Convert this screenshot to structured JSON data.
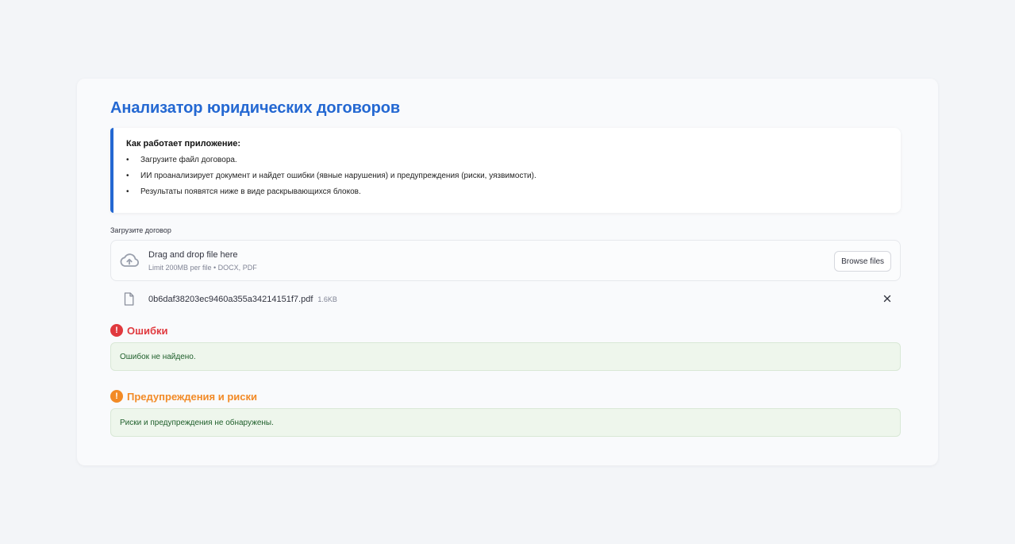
{
  "app": {
    "title": "Анализатор юридических договоров",
    "accent_color": "#2468d2"
  },
  "info": {
    "heading": "Как работает приложение:",
    "bullet": "•",
    "items": [
      "Загрузите файл договора.",
      "ИИ проанализирует документ и найдет ошибки (явные нарушения) и предупреждения (риски, уязвимости).",
      "Результаты появятся ниже в виде раскрывающихся блоков."
    ]
  },
  "uploader": {
    "label": "Загрузите договор",
    "drop_text": "Drag and drop file here",
    "limit_text": "Limit 200MB per file • DOCX, PDF",
    "browse_label": "Browse files",
    "icon": "cloud-upload-icon"
  },
  "uploaded_file": {
    "name": "0b6daf38203ec9460a355a34214151f7.pdf",
    "size": "1.6KB",
    "icon": "file-icon",
    "remove_icon": "close-icon"
  },
  "errors": {
    "title": "Ошибки",
    "badge": "!",
    "color": "#e0393e",
    "message": "Ошибок не найдено."
  },
  "warnings": {
    "title": "Предупреждения и риски",
    "badge": "!",
    "color": "#f28a26",
    "message": "Риски и предупреждения не обнаружены."
  }
}
